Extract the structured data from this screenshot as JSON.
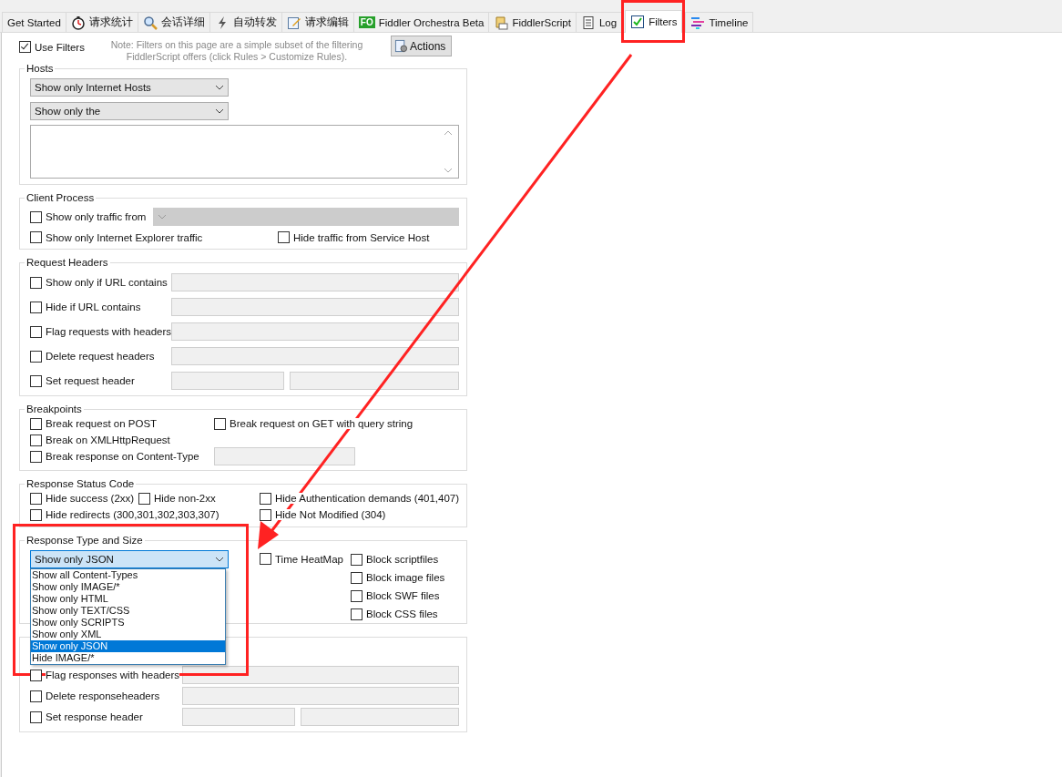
{
  "tabs": [
    {
      "label": "Get Started",
      "selected": false
    },
    {
      "label": "请求统计",
      "selected": false
    },
    {
      "label": "会话详细",
      "selected": false
    },
    {
      "label": "自动转发",
      "selected": false
    },
    {
      "label": "请求编辑",
      "selected": false
    },
    {
      "label": "Fiddler Orchestra Beta",
      "badge": "FO",
      "selected": false
    },
    {
      "label": "FiddlerScript",
      "selected": false
    },
    {
      "label": "Log",
      "selected": false
    },
    {
      "label": "Filters",
      "selected": true
    },
    {
      "label": "Timeline",
      "selected": false
    }
  ],
  "use_filters": {
    "label": "Use Filters",
    "checked": true
  },
  "note": "Note: Filters on this page are a simple subset of the filtering FiddlerScript offers (click Rules > Customize Rules).",
  "actions_button": "Actions",
  "hosts": {
    "title": "Hosts",
    "zone_select": "Show only Internet Hosts",
    "host_select": "Show only the"
  },
  "client_process": {
    "title": "Client Process",
    "traffic_from": {
      "label": "Show only traffic from",
      "checked": false
    },
    "ie_traffic": {
      "label": "Show only Internet Explorer traffic",
      "checked": false
    },
    "service_host": {
      "label": "Hide traffic from Service Host",
      "checked": false
    }
  },
  "request_headers": {
    "title": "Request Headers",
    "rows": [
      {
        "label": "Show only if URL contains",
        "checked": false,
        "kind": "single"
      },
      {
        "label": "Hide if URL contains",
        "checked": false,
        "kind": "single"
      },
      {
        "label": "Flag requests with headers",
        "checked": false,
        "kind": "single"
      },
      {
        "label": "Delete request headers",
        "checked": false,
        "kind": "single"
      },
      {
        "label": "Set request header",
        "checked": false,
        "kind": "pair"
      }
    ]
  },
  "breakpoints": {
    "title": "Breakpoints",
    "post": {
      "label": "Break request on POST",
      "checked": false
    },
    "get_query": {
      "label": "Break request on GET with query string",
      "checked": false
    },
    "xhr": {
      "label": "Break on XMLHttpRequest",
      "checked": false
    },
    "content_type": {
      "label": "Break response on Content-Type",
      "checked": false
    }
  },
  "status_code": {
    "title": "Response Status Code",
    "success": {
      "label": "Hide success (2xx)",
      "checked": false
    },
    "non_2xx": {
      "label": "Hide non-2xx",
      "checked": false
    },
    "auth": {
      "label": "Hide Authentication demands (401,407)",
      "checked": false
    },
    "redirects": {
      "label": "Hide redirects (300,301,302,303,307)",
      "checked": false
    },
    "not_modified": {
      "label": "Hide Not Modified (304)",
      "checked": false
    }
  },
  "response_type": {
    "title": "Response Type and Size",
    "select": "Show only JSON",
    "options": [
      {
        "label": "Show all Content-Types",
        "selected": false
      },
      {
        "label": "Show only IMAGE/*",
        "selected": false
      },
      {
        "label": "Show only HTML",
        "selected": false
      },
      {
        "label": "Show only TEXT/CSS",
        "selected": false
      },
      {
        "label": "Show only SCRIPTS",
        "selected": false
      },
      {
        "label": "Show only XML",
        "selected": false
      },
      {
        "label": "Show only JSON",
        "selected": true
      },
      {
        "label": "Hide IMAGE/*",
        "selected": false
      }
    ],
    "heatmap": {
      "label": "Time HeatMap",
      "checked": false
    },
    "blocks": [
      {
        "label": "Block scriptfiles",
        "checked": false
      },
      {
        "label": "Block image files",
        "checked": false
      },
      {
        "label": "Block SWF files",
        "checked": false
      },
      {
        "label": "Block CSS files",
        "checked": false
      }
    ]
  },
  "response_headers": {
    "rows": [
      {
        "label": "Flag responses with headers",
        "checked": false,
        "kind": "single"
      },
      {
        "label": "Delete responseheaders",
        "checked": false,
        "kind": "single"
      },
      {
        "label": "Set response header",
        "checked": false,
        "kind": "pair"
      }
    ]
  }
}
